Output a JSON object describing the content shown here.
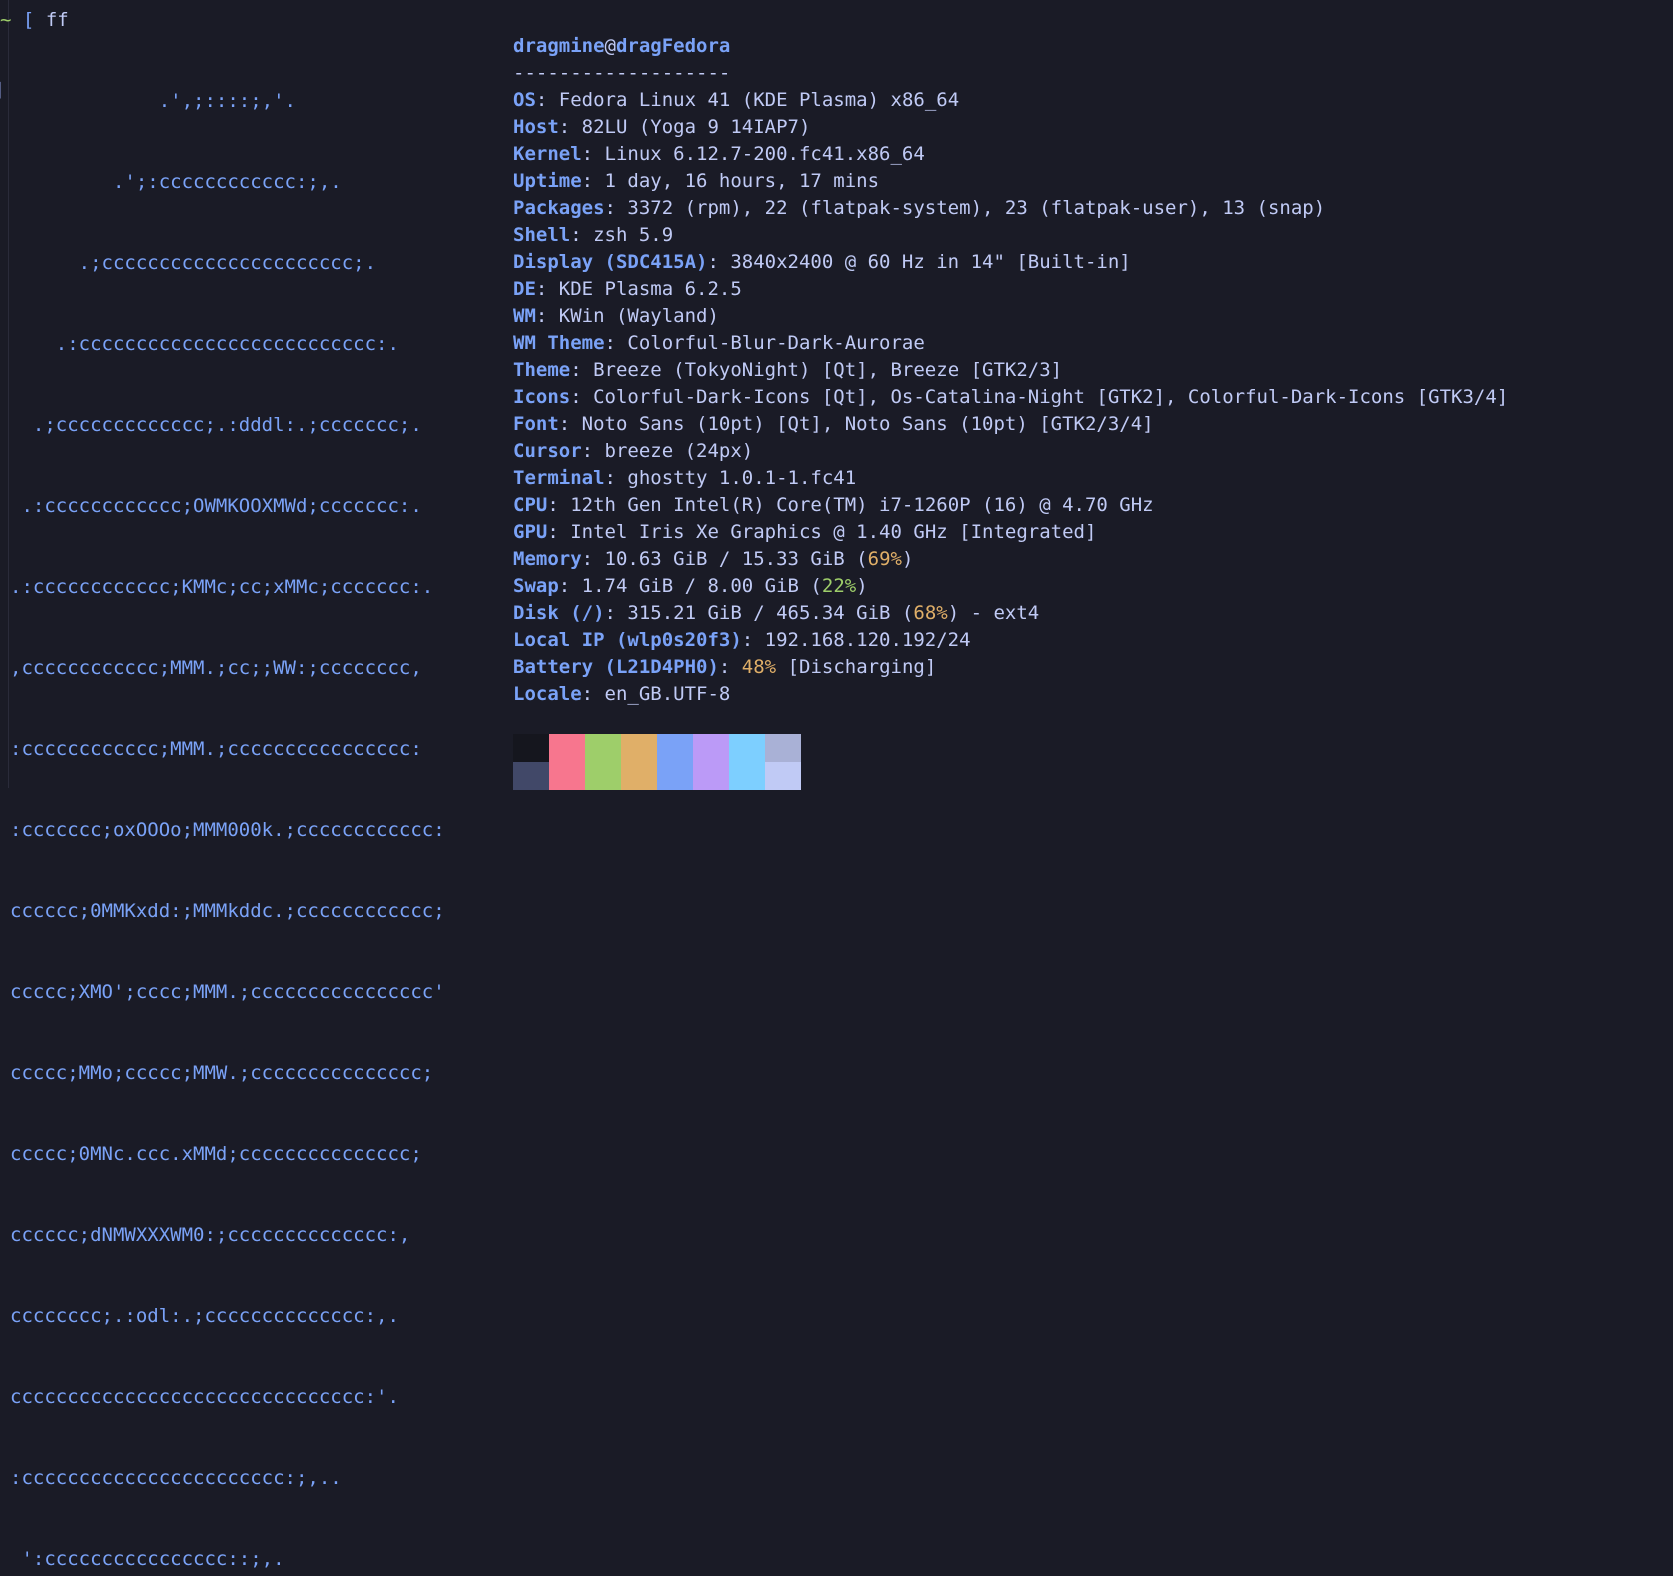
{
  "prompt": {
    "tilde": "~",
    "bracket": "[",
    "command": "ff"
  },
  "logo": {
    "lines": [
      "             .',;::::;,'.",
      "         .';:cccccccccccc:;,.",
      "      .;cccccccccccccccccccccc;.",
      "    .:cccccccccccccccccccccccccc:.",
      "  .;ccccccccccccc;.:dddl:.;ccccccc;.",
      " .:cccccccccccc;OWMKOOXMWd;ccccccc:.",
      ".:cccccccccccc;KMMc;cc;xMMc;ccccccc:.",
      ",cccccccccccc;MMM.;cc;;WW:;cccccccc,",
      ":cccccccccccc;MMM.;cccccccccccccccc:",
      ":ccccccc;oxOOOo;MMM000k.;cccccccccccc:",
      "cccccc;0MMKxdd:;MMMkddc.;cccccccccccc;",
      "ccccc;XMO';cccc;MMM.;cccccccccccccccc'",
      "ccccc;MMo;ccccc;MMW.;ccccccccccccccc;",
      "ccccc;0MNc.ccc.xMMd;ccccccccccccccc;",
      "cccccc;dNMWXXXWM0:;cccccccccccccc:,",
      "cccccccc;.:odl:.;cccccccccccccc:,.",
      "ccccccccccccccccccccccccccccccc:'.",
      ":ccccccccccccccccccccccc:;,..",
      " ':cccccccccccccccc::;,."
    ]
  },
  "info": {
    "user": "dragmine",
    "at": "@",
    "host": "dragFedora",
    "separator": "-------------------",
    "os": {
      "key": "OS",
      "value": ": Fedora Linux 41 (KDE Plasma) x86_64"
    },
    "host_model": {
      "key": "Host",
      "value": ": 82LU (Yoga 9 14IAP7)"
    },
    "kernel": {
      "key": "Kernel",
      "value": ": Linux 6.12.7-200.fc41.x86_64"
    },
    "uptime": {
      "key": "Uptime",
      "value": ": 1 day, 16 hours, 17 mins"
    },
    "packages": {
      "key": "Packages",
      "value": ": 3372 (rpm), 22 (flatpak-system), 23 (flatpak-user), 13 (snap)"
    },
    "shell": {
      "key": "Shell",
      "value": ": zsh 5.9"
    },
    "display": {
      "key": "Display (SDC415A)",
      "value": ": 3840x2400 @ 60 Hz in 14\" [Built-in]"
    },
    "de": {
      "key": "DE",
      "value": ": KDE Plasma 6.2.5"
    },
    "wm": {
      "key": "WM",
      "value": ": KWin (Wayland)"
    },
    "wm_theme": {
      "key": "WM Theme",
      "value": ": Colorful-Blur-Dark-Aurorae"
    },
    "theme": {
      "key": "Theme",
      "value": ": Breeze (TokyoNight) [Qt], Breeze [GTK2/3]"
    },
    "icons": {
      "key": "Icons",
      "value": ": Colorful-Dark-Icons [Qt], Os-Catalina-Night [GTK2], Colorful-Dark-Icons [GTK3/4]"
    },
    "font": {
      "key": "Font",
      "value": ": Noto Sans (10pt) [Qt], Noto Sans (10pt) [GTK2/3/4]"
    },
    "cursor": {
      "key": "Cursor",
      "value": ": breeze (24px)"
    },
    "terminal": {
      "key": "Terminal",
      "value": ": ghostty 1.0.1-1.fc41"
    },
    "cpu": {
      "key": "CPU",
      "value": ": 12th Gen Intel(R) Core(TM) i7-1260P (16) @ 4.70 GHz"
    },
    "gpu": {
      "key": "GPU",
      "value": ": Intel Iris Xe Graphics @ 1.40 GHz [Integrated]"
    },
    "memory": {
      "key": "Memory",
      "value": ": 10.63 GiB / 15.33 GiB (",
      "pct": "69%",
      "tail": ")"
    },
    "swap": {
      "key": "Swap",
      "value": ": 1.74 GiB / 8.00 GiB (",
      "pct": "22%",
      "tail": ")"
    },
    "disk": {
      "key": "Disk (/)",
      "value": ": 315.21 GiB / 465.34 GiB (",
      "pct": "68%",
      "tail": ") - ext4"
    },
    "local_ip": {
      "key": "Local IP (wlp0s20f3)",
      "value": ": 192.168.120.192/24"
    },
    "battery": {
      "key": "Battery (L21D4PH0)",
      "value": ": ",
      "pct": "48%",
      "tail": " [Discharging]"
    },
    "locale": {
      "key": "Locale",
      "value": ": en_GB.UTF-8"
    }
  },
  "palette": {
    "normal": [
      "#15161e",
      "#f7768e",
      "#9ece6a",
      "#e0af68",
      "#7aa2f7",
      "#bb9af7",
      "#7dcfff",
      "#a9b1d6"
    ],
    "bright": [
      "#414868",
      "#f7768e",
      "#9ece6a",
      "#e0af68",
      "#7aa2f7",
      "#bb9af7",
      "#7dcfff",
      "#c0caf5"
    ]
  }
}
